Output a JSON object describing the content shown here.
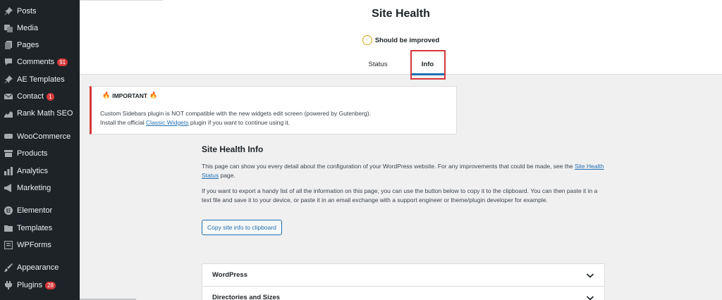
{
  "sidebar": {
    "items": [
      {
        "label": "Posts",
        "icon": "pin-icon"
      },
      {
        "label": "Media",
        "icon": "media-icon"
      },
      {
        "label": "Pages",
        "icon": "pages-icon"
      },
      {
        "label": "Comments",
        "icon": "comment-icon",
        "badge": "91"
      },
      {
        "label": "AE Templates",
        "icon": "pin-icon"
      },
      {
        "label": "Contact",
        "icon": "mail-icon",
        "badge": "1"
      },
      {
        "label": "Rank Math SEO",
        "icon": "chart-line-icon"
      },
      {
        "label": "WooCommerce",
        "icon": "woocommerce-icon"
      },
      {
        "label": "Products",
        "icon": "archive-icon"
      },
      {
        "label": "Analytics",
        "icon": "bar-chart-icon"
      },
      {
        "label": "Marketing",
        "icon": "megaphone-icon"
      },
      {
        "label": "Elementor",
        "icon": "elementor-icon"
      },
      {
        "label": "Templates",
        "icon": "folder-icon"
      },
      {
        "label": "WPForms",
        "icon": "form-icon"
      },
      {
        "label": "Appearance",
        "icon": "brush-icon"
      },
      {
        "label": "Plugins",
        "icon": "plugin-icon",
        "badge": "28"
      }
    ]
  },
  "header": {
    "title": "Site Health",
    "status": "Should be improved",
    "status_color": "#dba617",
    "tabs": [
      {
        "label": "Status",
        "active": false
      },
      {
        "label": "Info",
        "active": true
      }
    ]
  },
  "notice": {
    "title": "IMPORTANT",
    "line1": "Custom Sidebars plugin is NOT compatible with the new widgets edit screen (powered by Gutenberg).",
    "line2_pre": "Install the official ",
    "line2_link": "Classic Widgets",
    "line2_post": " plugin if you want to continue using it."
  },
  "main": {
    "heading": "Site Health Info",
    "p1_pre": "This page can show you every detail about the configuration of your WordPress website. For any improvements that could be made, see the ",
    "p1_link": "Site Health Status",
    "p1_post": " page.",
    "p2": "If you want to export a handy list of all the information on this page, you can use the button below to copy it to the clipboard. You can then paste it in a text file and save it to your device, or paste it in an email exchange with a support engineer or theme/plugin developer for example.",
    "copy_button": "Copy site info to clipboard",
    "sections": [
      "WordPress",
      "Directories and Sizes"
    ]
  },
  "colors": {
    "sidebar_bg": "#1d2327",
    "accent": "#2271b1",
    "danger": "#d63638"
  }
}
